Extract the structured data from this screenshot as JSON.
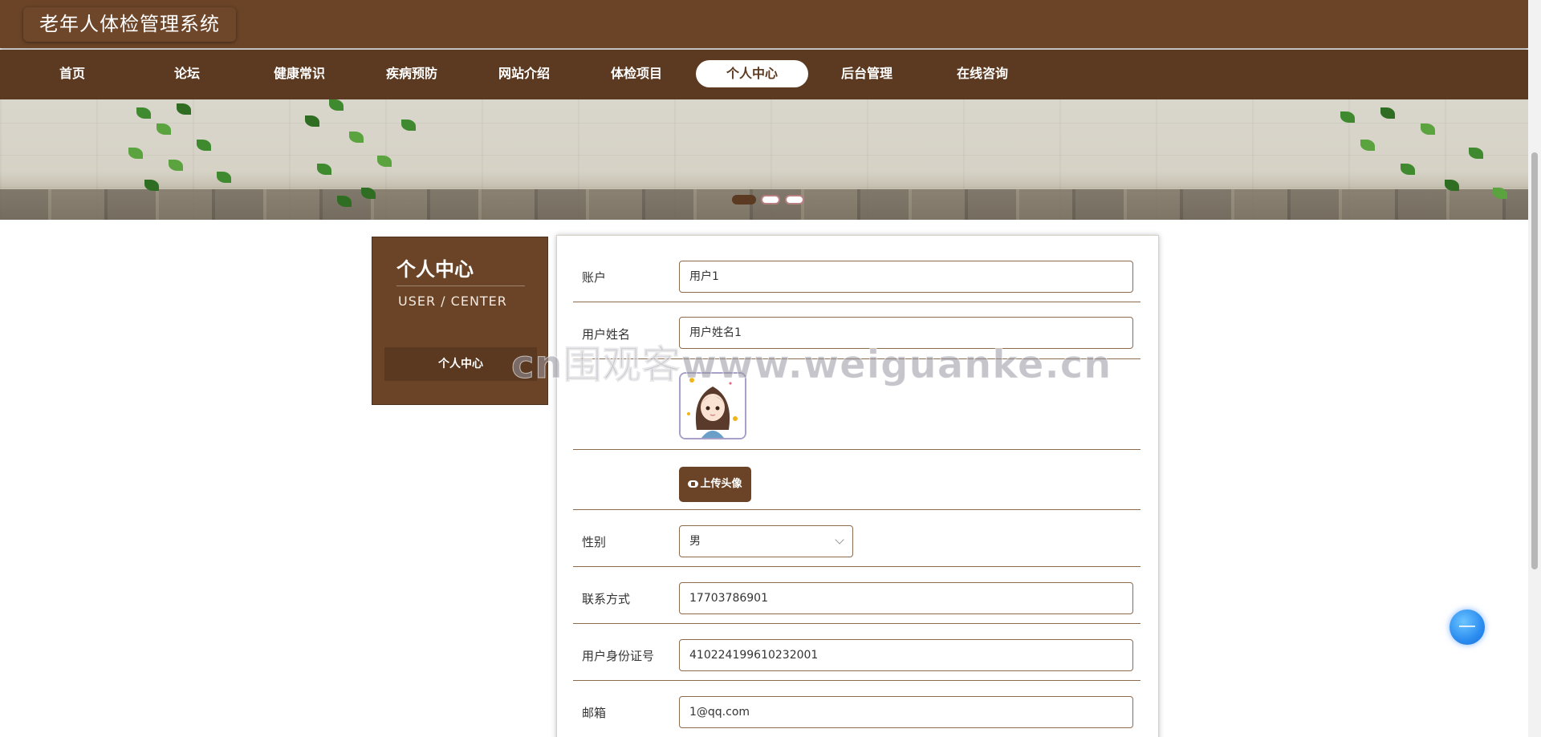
{
  "header": {
    "site_title": "老年人体检管理系统"
  },
  "nav": {
    "items": [
      {
        "label": "首页"
      },
      {
        "label": "论坛"
      },
      {
        "label": "健康常识"
      },
      {
        "label": "疾病预防"
      },
      {
        "label": "网站介绍"
      },
      {
        "label": "体检项目"
      },
      {
        "label": "个人中心",
        "active": true
      },
      {
        "label": "后台管理"
      },
      {
        "label": "在线咨询"
      }
    ]
  },
  "banner": {
    "slide_count": 3,
    "active_slide": 1
  },
  "sidebar": {
    "title": "个人中心",
    "subtitle": "USER / CENTER",
    "menu": [
      {
        "label": "个人中心"
      }
    ]
  },
  "form": {
    "account": {
      "label": "账户",
      "value": "用户1"
    },
    "user_name": {
      "label": "用户姓名",
      "value": "用户姓名1"
    },
    "avatar": {
      "icon": "avatar-image"
    },
    "upload_label": "上传头像",
    "gender": {
      "label": "性别",
      "value": "男"
    },
    "contact": {
      "label": "联系方式",
      "value": "17703786901"
    },
    "id_number": {
      "label": "用户身份证号",
      "value": "410224199610232001"
    },
    "email": {
      "label": "邮箱",
      "value": "1@qq.com"
    }
  },
  "watermark": "cn围观客www.weiguanke.cn",
  "colors": {
    "brand_brown": "#6b4427",
    "nav_brown": "#5c3a21",
    "accent_blue": "#2b8cf0"
  }
}
